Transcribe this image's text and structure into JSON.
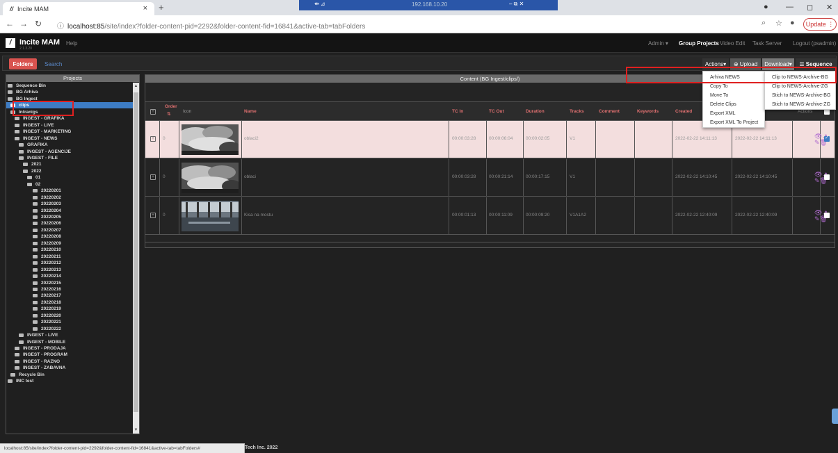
{
  "browser": {
    "tab_title": "Incite MAM",
    "tab_logo": "//",
    "tab_close": "×",
    "new_tab": "+",
    "remote_ip": "192.168.10.20",
    "url_host": "localhost:85",
    "url_path": "/site/index?folder-content-pid=2292&folder-content-fid=16841&active-tab=tabFolders",
    "update_label": "Update"
  },
  "app": {
    "name": "Incite MAM",
    "version": "2.1.3.20",
    "help": "Help",
    "nav": {
      "admin": "Admin ▾",
      "group_projects": "Group Projects",
      "video_edit": "Video Edit",
      "task_server": "Task Server",
      "logout": "Logout (psadmin)"
    }
  },
  "toolbar": {
    "folders": "Folders",
    "search": "Search",
    "actions": "Actions▾",
    "upload": "⊕ Upload",
    "download": "Download▾",
    "sequence": "☰ Sequence"
  },
  "projects": {
    "title": "Projects",
    "items": [
      {
        "label": "Sequence Bin",
        "level": 0
      },
      {
        "label": "BG Arhiva",
        "level": 0
      },
      {
        "label": "BG Ingest",
        "level": 0
      },
      {
        "label": "clips",
        "level": 1,
        "selected": true
      },
      {
        "label": "Intranigs",
        "level": 1
      },
      {
        "label": "INGEST - GRAFIKA",
        "level": 2
      },
      {
        "label": "INGEST - LIVE",
        "level": 2
      },
      {
        "label": "INGEST - MARKETING",
        "level": 2
      },
      {
        "label": "INGEST - NEWS",
        "level": 2
      },
      {
        "label": "GRAFIKA",
        "level": 3
      },
      {
        "label": "INGEST - AGENCIJE",
        "level": 3
      },
      {
        "label": "INGEST - FILE",
        "level": 3
      },
      {
        "label": "2021",
        "level": 4
      },
      {
        "label": "2022",
        "level": 4
      },
      {
        "label": "01",
        "level": 5
      },
      {
        "label": "02",
        "level": 5
      },
      {
        "label": "20220201",
        "level": 6
      },
      {
        "label": "20220202",
        "level": 6
      },
      {
        "label": "20220203",
        "level": 6
      },
      {
        "label": "20220204",
        "level": 6
      },
      {
        "label": "20220205",
        "level": 6
      },
      {
        "label": "20220206",
        "level": 6
      },
      {
        "label": "20220207",
        "level": 6
      },
      {
        "label": "20220208",
        "level": 6
      },
      {
        "label": "20220209",
        "level": 6
      },
      {
        "label": "20220210",
        "level": 6
      },
      {
        "label": "20220211",
        "level": 6
      },
      {
        "label": "20220212",
        "level": 6
      },
      {
        "label": "20220213",
        "level": 6
      },
      {
        "label": "20220214",
        "level": 6
      },
      {
        "label": "20220215",
        "level": 6
      },
      {
        "label": "20220216",
        "level": 6
      },
      {
        "label": "20220217",
        "level": 6
      },
      {
        "label": "20220218",
        "level": 6
      },
      {
        "label": "20220219",
        "level": 6
      },
      {
        "label": "20220220",
        "level": 6
      },
      {
        "label": "20220221",
        "level": 6
      },
      {
        "label": "20220222",
        "level": 6
      },
      {
        "label": "INGEST - LIVE",
        "level": 3
      },
      {
        "label": "INGEST - MOBILE",
        "level": 3
      },
      {
        "label": "INGEST - PRODAJA",
        "level": 2
      },
      {
        "label": "INGEST - PROGRAM",
        "level": 2
      },
      {
        "label": "INGEST - RAZNO",
        "level": 2
      },
      {
        "label": "INGEST - ZABAVNA",
        "level": 2
      },
      {
        "label": "Recycle Bin",
        "level": 1
      },
      {
        "label": "IMC test",
        "level": 0
      }
    ]
  },
  "content": {
    "title": "Content (BG Ingest/clips/)",
    "columns": {
      "order": "Order",
      "icon": "Icon",
      "name": "Name",
      "tc_in": "TC In",
      "tc_out": "TC Out",
      "duration": "Duration",
      "tracks": "Tracks",
      "comment": "Comment",
      "keywords": "Keywords",
      "created": "Created",
      "actions": "Actions"
    },
    "rows": [
      {
        "order": "0",
        "name": "oblaci2",
        "tc_in": "00:00:03:28",
        "tc_out": "00:00:06:04",
        "duration": "00:00:02:05",
        "tracks": "V1",
        "created": "2022-02-22 14:11:13",
        "modified": "2022-02-22 14:11:13",
        "checked": true
      },
      {
        "order": "0",
        "name": "oblaci",
        "tc_in": "00:00:03:28",
        "tc_out": "00:00:21:14",
        "duration": "00:00:17:15",
        "tracks": "V1",
        "created": "2022-02-22 14:10:45",
        "modified": "2022-02-22 14:10:45",
        "checked": false
      },
      {
        "order": "0",
        "name": "Kisa na mostu",
        "tc_in": "00:00:01:13",
        "tc_out": "00:00:11:09",
        "duration": "00:00:09:20",
        "tracks": "V1A1A2",
        "created": "2022-02-22 12:40:09",
        "modified": "2022-02-22 12:40:09",
        "checked": false
      }
    ]
  },
  "actions_menu": {
    "items": [
      "Arhiva NEWS",
      "Copy To",
      "Move To",
      "Delete Clips",
      "Export XML",
      "Export XML To Project"
    ]
  },
  "archive_submenu": {
    "items": [
      "Clip to NEWS-Archive-BG",
      "Clip to NEWS-Archive-ZG",
      "Stich to NEWS-Archive-BG",
      "Stich to NEWS-Archive-ZG"
    ]
  },
  "status": {
    "url": "localhost:85/site/index?folder-content-pid=2292&folder-content-fid=16841&active-tab=tabFolders#",
    "copyright": "Tech Inc. 2022"
  }
}
